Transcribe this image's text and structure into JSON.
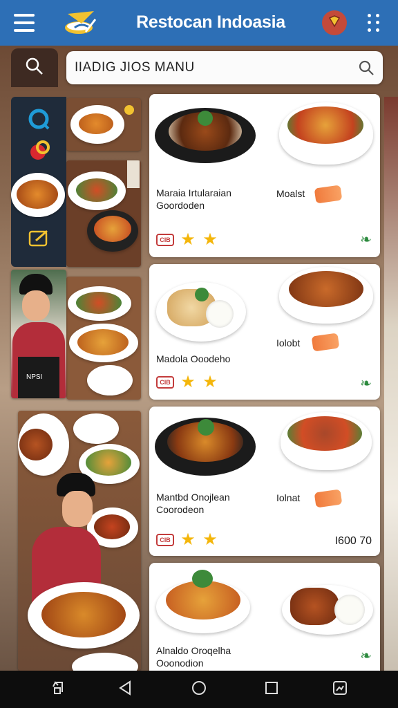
{
  "app": {
    "title": "Restocan Indoasia"
  },
  "search": {
    "value": "IIADIG JIOS MANU"
  },
  "menu_items": [
    {
      "name": "Maraia Irtularaian Goordoden",
      "side": "Moalst",
      "badge": "CIB",
      "price": ""
    },
    {
      "name": "Madola Ooodeho",
      "side": "Iolobt",
      "badge": "CIB",
      "price": ""
    },
    {
      "name": "Mantbd Onojlean Coorodeon",
      "side": "Iolnat",
      "badge": "CIB",
      "price": "I600 70"
    },
    {
      "name": "Alnaldo Oroqelha Ooonodion",
      "side": "",
      "badge": "",
      "price": ""
    }
  ],
  "left_photo_label": "NPSI",
  "colors": {
    "appbar": "#2d6fb6",
    "accent_red": "#c44a3a",
    "star": "#f4b60b",
    "leaf": "#2c8a3e"
  }
}
